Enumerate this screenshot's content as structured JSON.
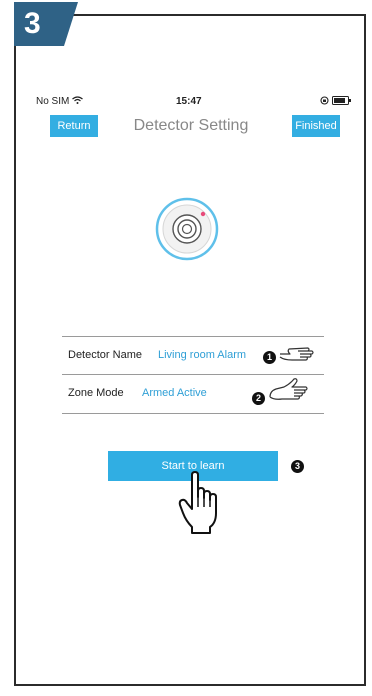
{
  "step": {
    "number": "3"
  },
  "status_bar": {
    "carrier": "No SIM",
    "time": "15:47"
  },
  "nav": {
    "return_label": "Return",
    "title": "Detector Setting",
    "finished_label": "Finished"
  },
  "fields": [
    {
      "label": "Detector Name",
      "value": "Living room Alarm",
      "marker": "1"
    },
    {
      "label": "Zone Mode",
      "value": "Armed Active",
      "marker": "2"
    }
  ],
  "learn": {
    "label": "Start to learn",
    "marker": "3"
  },
  "icons": {
    "wifi": "wifi-icon",
    "lock": "orientation-lock-icon",
    "battery": "battery-icon",
    "camera": "detector-camera-icon",
    "hand": "pointing-hand-icon"
  },
  "colors": {
    "accent": "#33aee2",
    "badge": "#2f6286",
    "value_text": "#2f9fd6"
  }
}
